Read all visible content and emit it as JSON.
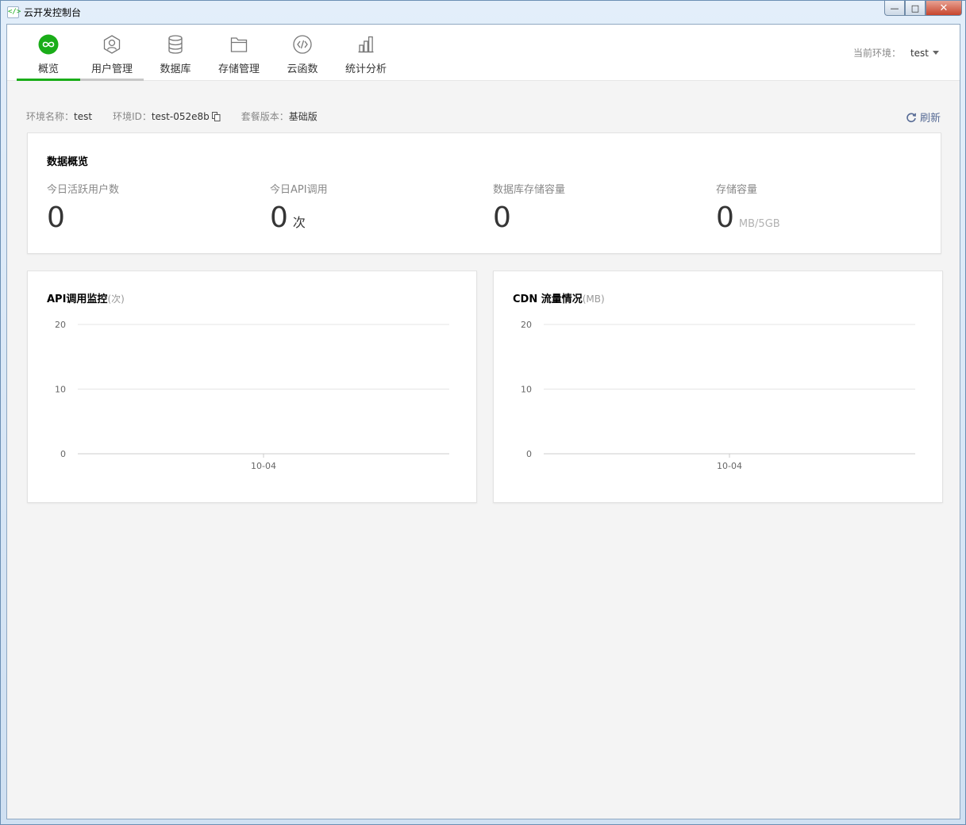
{
  "window": {
    "app_icon": "</>",
    "title": "云开发控制台",
    "buttons": {
      "minimize": "—",
      "maximize": "□",
      "close": "✕"
    }
  },
  "nav": {
    "tabs": [
      {
        "label": "概览",
        "icon": "infinity-icon",
        "active": true
      },
      {
        "label": "用户管理",
        "icon": "user-icon",
        "active": false
      },
      {
        "label": "数据库",
        "icon": "database-icon",
        "active": false
      },
      {
        "label": "存储管理",
        "icon": "folder-icon",
        "active": false
      },
      {
        "label": "云函数",
        "icon": "code-icon",
        "active": false
      },
      {
        "label": "统计分析",
        "icon": "bar-chart-icon",
        "active": false
      }
    ],
    "env_label": "当前环境：",
    "env_value": "test"
  },
  "info": {
    "env_name_label": "环境名称：",
    "env_name": "test",
    "env_id_label": "环境ID：",
    "env_id": "test-052e8b",
    "plan_label": "套餐版本：",
    "plan": "基础版",
    "refresh": "刷新"
  },
  "overview": {
    "title": "数据概览",
    "metrics": [
      {
        "label": "今日活跃用户数",
        "value": "0",
        "unit": ""
      },
      {
        "label": "今日API调用",
        "value": "0",
        "unit": "次"
      },
      {
        "label": "数据库存储容量",
        "value": "0",
        "unit": ""
      },
      {
        "label": "存储容量",
        "value": "0",
        "unit": "MB/5GB"
      }
    ]
  },
  "colors": {
    "accent": "#1aad19",
    "link": "#576b95",
    "grid": "#e5e5e5"
  },
  "chart_data": [
    {
      "type": "line",
      "title": "API调用监控",
      "title_unit": "(次)",
      "categories": [
        "10-04"
      ],
      "series": [
        {
          "values": [
            0
          ]
        }
      ],
      "ylim": [
        0,
        20
      ],
      "yticks": [
        0,
        10,
        20
      ],
      "grid": true
    },
    {
      "type": "line",
      "title": "CDN 流量情况",
      "title_unit": "(MB)",
      "categories": [
        "10-04"
      ],
      "series": [
        {
          "values": [
            0
          ]
        }
      ],
      "ylim": [
        0,
        20
      ],
      "yticks": [
        0,
        10,
        20
      ],
      "grid": true
    }
  ]
}
